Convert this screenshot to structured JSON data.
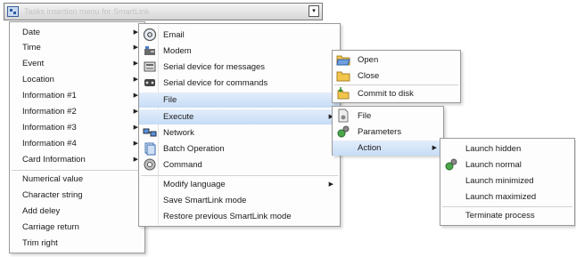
{
  "header": {
    "title": "Tasks insertion menu for SmartLink",
    "dropdown_glyph": "▾"
  },
  "menu1": {
    "items": [
      {
        "label": "Date",
        "submenu": true
      },
      {
        "label": "Time",
        "submenu": true
      },
      {
        "label": "Event",
        "submenu": true
      },
      {
        "label": "Location",
        "submenu": true
      },
      {
        "label": "Information #1",
        "submenu": true
      },
      {
        "label": "Information #2",
        "submenu": true
      },
      {
        "label": "Information #3",
        "submenu": true
      },
      {
        "label": "Information #4",
        "submenu": true
      },
      {
        "label": "Card Information",
        "submenu": true
      },
      {
        "label": "Numerical value"
      },
      {
        "label": "Character string"
      },
      {
        "label": "Add deley"
      },
      {
        "label": "Carriage return"
      },
      {
        "label": "Trim right"
      }
    ]
  },
  "menu2": {
    "items": [
      {
        "label": "Email",
        "icon": "email-icon"
      },
      {
        "label": "Modem",
        "icon": "modem-icon"
      },
      {
        "label": "Serial device for messages",
        "icon": "serial-device-messages-icon"
      },
      {
        "label": "Serial device for commands",
        "icon": "serial-device-commands-icon"
      },
      {
        "label": "File",
        "highlighted": true
      },
      {
        "label": "Execute",
        "highlighted": true,
        "submenu": true
      },
      {
        "label": "Network",
        "icon": "network-icon"
      },
      {
        "label": "Batch Operation",
        "icon": "batch-operation-icon"
      },
      {
        "label": "Command",
        "icon": "command-icon"
      },
      {
        "label": "Modify language",
        "submenu": true
      },
      {
        "label": "Save SmartLink mode"
      },
      {
        "label": "Restore previous SmartLink mode"
      }
    ]
  },
  "menu3": {
    "items": [
      {
        "label": "Open",
        "icon": "open-folder-icon"
      },
      {
        "label": "Close",
        "icon": "close-folder-icon"
      },
      {
        "label": "Commit to disk",
        "icon": "commit-to-disk-icon"
      }
    ]
  },
  "menu4": {
    "items": [
      {
        "label": "File",
        "icon": "file-icon"
      },
      {
        "label": "Parameters",
        "icon": "parameters-icon"
      },
      {
        "label": "Action",
        "highlighted": true,
        "submenu": true
      }
    ]
  },
  "menu5": {
    "items": [
      {
        "label": "Launch hidden"
      },
      {
        "label": "Launch normal",
        "icon": "launch-icon"
      },
      {
        "label": "Launch minimized"
      },
      {
        "label": "Launch maximized"
      },
      {
        "label": "Terminate process"
      }
    ]
  },
  "glyphs": {
    "submenu_arrow": "▶"
  },
  "colors": {
    "highlight_top": "#e3eefb",
    "highlight_bottom": "#c6dcf6",
    "menu_border": "#9a9a9a"
  }
}
